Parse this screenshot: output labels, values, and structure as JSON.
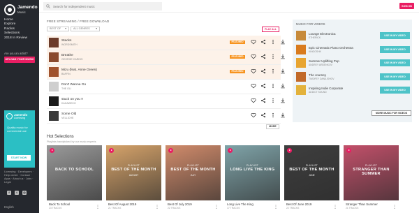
{
  "sidebar": {
    "logo_name": "Jamendo",
    "logo_sub": "Music",
    "nav": [
      "Home",
      "Explore",
      "Radios",
      "Selections",
      "2018 In Review"
    ],
    "artist_question": "Are you an artist?",
    "upload_button": "UPLOAD YOUR MUSIC",
    "ad": {
      "brand": "Jamendo",
      "brand_sub": "Licensing",
      "copy": "Quality music for commercial use",
      "button": "START NOW"
    },
    "footer_links": "Licensing · Developers · Help center · Contact · Apps · About us · Jobs · Legal",
    "language": "English"
  },
  "topbar": {
    "search_placeholder": "Search for independent music",
    "signin": "SIGN IN"
  },
  "free_streaming": {
    "title": "FREE STREAMING / FREE DOWNLOAD",
    "filter_period": "BEST OF",
    "filter_genre": "ALL GENRES",
    "play_all": "PLAY ALL",
    "badge_label": "FEATURED",
    "more": "MORE",
    "tracks": [
      {
        "title": "Stacks",
        "artist": "WORDSMITH",
        "featured": true,
        "color": "#6b3b2a"
      },
      {
        "title": "Breathe",
        "artist": "GEORGE CARDIS",
        "featured": true,
        "color": "#8a4a2e"
      },
      {
        "title": "Mizu (feat. Anne Green)",
        "artist": "BAFFIN",
        "featured": true,
        "color": "#a0522d"
      },
      {
        "title": "Don't Wanna Go",
        "artist": "THE OLI",
        "featured": false,
        "color": "#cfcfcf"
      },
      {
        "title": "stuck on you !!",
        "artist": "KAHAWEKO",
        "featured": false,
        "color": "#1b1b1b"
      },
      {
        "title": "Some Old",
        "artist": "VELLICHE",
        "featured": false,
        "color": "#3a3a3a"
      }
    ]
  },
  "music_for_videos": {
    "title": "MUSIC FOR VIDEOS",
    "use_label": "USE IN MY VIDEO",
    "more_label": "MORE MUSIC FOR VIDEOS",
    "items": [
      {
        "title": "Lounge Electronica",
        "artist": "ETHERICK",
        "color": "#c78a3a"
      },
      {
        "title": "Epic Cinematic Piano Orchestra",
        "artist": "KINOOSHK",
        "color": "#d97b1e"
      },
      {
        "title": "Summer Uplifting Pop",
        "artist": "ANDREY ARDENKOV",
        "color": "#e8a531"
      },
      {
        "title": "The Journey",
        "artist": "TIMOFEY DANILISHOV",
        "color": "#c26a2a"
      },
      {
        "title": "Inspiring Indie Corporate",
        "artist": "ADDICT SOUND",
        "color": "#e3b23c"
      }
    ]
  },
  "hot_selections": {
    "title": "Hot Selections",
    "subtitle": "Playlists handpicked by our music experts",
    "cards": [
      {
        "pre": "",
        "big": "BACK TO SCHOOL",
        "post": "",
        "name": "Back To School",
        "count": "23 TRACKS",
        "color": "#9a9a9a"
      },
      {
        "pre": "PLAYLIST",
        "big": "BEST OF THE MONTH",
        "post": "AUGUST",
        "name": "Best Of August 2019",
        "count": "21 TRACKS",
        "color": "#d6a36a"
      },
      {
        "pre": "PLAYLIST",
        "big": "BEST OF THE MONTH",
        "post": "JULY",
        "name": "Best Of July 2019",
        "count": "22 TRACKS",
        "color": "#d18b6b"
      },
      {
        "pre": "PLAYLIST",
        "big": "LONG LIVE THE KING",
        "post": "",
        "name": "Long Live The King",
        "count": "17 TRACKS",
        "color": "#7fa3a8"
      },
      {
        "pre": "PLAYLIST",
        "big": "BEST OF THE MONTH",
        "post": "JUNE",
        "name": "Best Of June 2019",
        "count": "22 TRACKS",
        "color": "#3e3e3e"
      },
      {
        "pre": "PLAYLIST",
        "big": "STRANGER THAN SUMMER",
        "post": "",
        "name": "Stranger Than Summer",
        "count": "21 TRACKS",
        "color": "#c2506a"
      }
    ]
  }
}
